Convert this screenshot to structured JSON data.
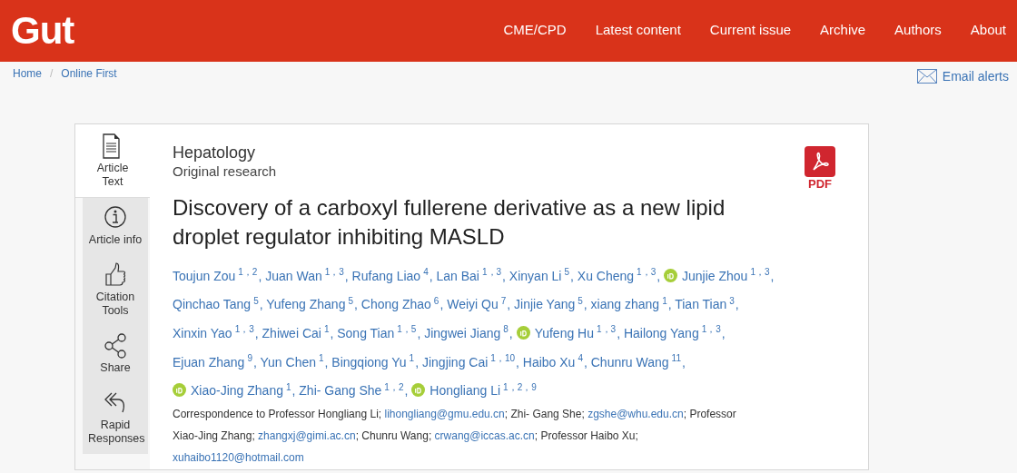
{
  "header": {
    "logo": "Gut",
    "nav": [
      {
        "label": "CME/CPD"
      },
      {
        "label": "Latest content"
      },
      {
        "label": "Current issue"
      },
      {
        "label": "Archive"
      },
      {
        "label": "Authors"
      },
      {
        "label": "About"
      }
    ]
  },
  "breadcrumb": {
    "items": [
      "Home",
      "Online First"
    ],
    "separators": [
      "/"
    ]
  },
  "email_alerts": "Email alerts",
  "side_tabs": [
    {
      "label": "Article Text",
      "selected": true
    },
    {
      "label": "Article info",
      "selected": false
    },
    {
      "label": "Citation Tools",
      "selected": false
    },
    {
      "label": "Share",
      "selected": false
    },
    {
      "label": "Rapid Responses",
      "selected": false
    }
  ],
  "article": {
    "section": "Hepatology",
    "type": "Original research",
    "pdf_label": "PDF",
    "title": "Discovery of a carboxyl fullerene derivative as a new lipid droplet regulator inhibiting MASLD",
    "authors": [
      {
        "name": "Toujun Zou",
        "sup": "1，2",
        "orcid": false,
        "sep": ","
      },
      {
        "name": "Juan Wan",
        "sup": "1，3",
        "orcid": false,
        "sep": ","
      },
      {
        "name": "Rufang Liao",
        "sup": "4",
        "orcid": false,
        "sep": ","
      },
      {
        "name": "Lan Bai",
        "sup": "1，3",
        "orcid": false,
        "sep": ","
      },
      {
        "name": "Xinyan Li",
        "sup": "5",
        "orcid": false,
        "sep": ","
      },
      {
        "name": "Xu Cheng",
        "sup": "1，3",
        "orcid": false,
        "sep": ","
      },
      {
        "name": "Junjie Zhou",
        "sup": "1，3",
        "orcid": true,
        "sep": ","
      },
      {
        "name": "Qinchao Tang",
        "sup": "5",
        "orcid": false,
        "sep": ","
      },
      {
        "name": "Yufeng Zhang",
        "sup": "5",
        "orcid": false,
        "sep": ","
      },
      {
        "name": "Chong Zhao",
        "sup": "6",
        "orcid": false,
        "sep": ","
      },
      {
        "name": "Weiyi Qu",
        "sup": "7",
        "orcid": false,
        "sep": ","
      },
      {
        "name": "Jinjie Yang",
        "sup": "5",
        "orcid": false,
        "sep": ","
      },
      {
        "name": "xiang zhang",
        "sup": "1",
        "orcid": false,
        "sep": ","
      },
      {
        "name": "Tian Tian",
        "sup": "3",
        "orcid": false,
        "sep": ","
      },
      {
        "name": "Xinxin Yao",
        "sup": "1，3",
        "orcid": false,
        "sep": ","
      },
      {
        "name": "Zhiwei Cai",
        "sup": "1",
        "orcid": false,
        "sep": ","
      },
      {
        "name": "Song Tian",
        "sup": "1，5",
        "orcid": false,
        "sep": ","
      },
      {
        "name": "Jingwei Jiang",
        "sup": "8",
        "orcid": false,
        "sep": ","
      },
      {
        "name": "Yufeng Hu",
        "sup": "1，3",
        "orcid": true,
        "sep": ","
      },
      {
        "name": "Hailong Yang",
        "sup": "1，3",
        "orcid": false,
        "sep": ","
      },
      {
        "name": "Ejuan Zhang",
        "sup": "9",
        "orcid": false,
        "sep": ","
      },
      {
        "name": "Yun Chen",
        "sup": "1",
        "orcid": false,
        "sep": ","
      },
      {
        "name": "Bingqiong Yu",
        "sup": "1",
        "orcid": false,
        "sep": ","
      },
      {
        "name": "Jingjing Cai",
        "sup": "1，10",
        "orcid": false,
        "sep": ","
      },
      {
        "name": "Haibo Xu",
        "sup": "4",
        "orcid": false,
        "sep": ","
      },
      {
        "name": "Chunru Wang",
        "sup": "11",
        "orcid": false,
        "sep": ","
      },
      {
        "name": "Xiao-Jing Zhang",
        "sup": "1",
        "orcid": true,
        "sep": ","
      },
      {
        "name": "Zhi- Gang She",
        "sup": "1，2",
        "orcid": false,
        "sep": ","
      },
      {
        "name": "Hongliang Li",
        "sup": "1，2，9",
        "orcid": true
      }
    ],
    "correspondence": [
      {
        "kind": "text",
        "text": "Correspondence to Professor Hongliang Li; "
      },
      {
        "kind": "email",
        "text": "lihongliang@gmu.edu.cn"
      },
      {
        "kind": "text",
        "text": "; Zhi- Gang She; "
      },
      {
        "kind": "email",
        "text": "zgshe@whu.edu.cn"
      },
      {
        "kind": "text",
        "text": "; Professor Xiao-Jing Zhang; "
      },
      {
        "kind": "email",
        "text": "zhangxj@gimi.ac.cn"
      },
      {
        "kind": "text",
        "text": "; Chunru Wang; "
      },
      {
        "kind": "email",
        "text": "crwang@iccas.ac.cn"
      },
      {
        "kind": "text",
        "text": "; Professor Haibo Xu; "
      },
      {
        "kind": "email",
        "text": "xuhaibo1120@hotmail.com"
      }
    ]
  }
}
